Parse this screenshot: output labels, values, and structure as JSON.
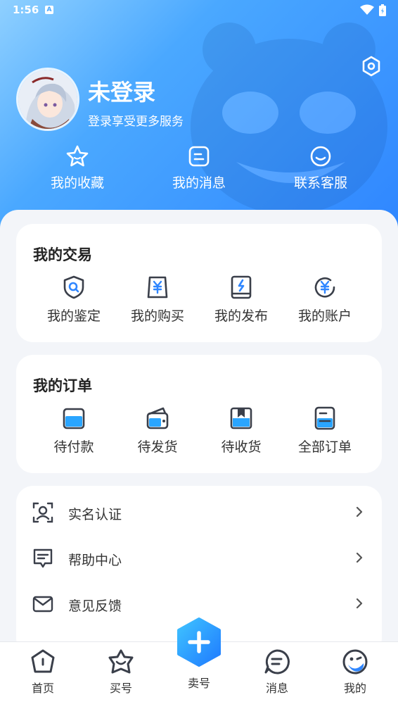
{
  "status_bar": {
    "time": "1:56",
    "notification_badge": "A"
  },
  "profile": {
    "name": "未登录",
    "subtitle": "登录享受更多服务"
  },
  "quick_actions": [
    {
      "label": "我的收藏",
      "icon": "star-icon"
    },
    {
      "label": "我的消息",
      "icon": "message-icon"
    },
    {
      "label": "联系客服",
      "icon": "smile-icon"
    }
  ],
  "trade": {
    "title": "我的交易",
    "items": [
      {
        "label": "我的鉴定",
        "icon": "shield-search-icon"
      },
      {
        "label": "我的购买",
        "icon": "yen-bag-icon"
      },
      {
        "label": "我的发布",
        "icon": "book-publish-icon"
      },
      {
        "label": "我的账户",
        "icon": "yen-circle-icon"
      }
    ]
  },
  "orders": {
    "title": "我的订单",
    "items": [
      {
        "label": "待付款",
        "icon": "card-icon"
      },
      {
        "label": "待发货",
        "icon": "wallet-icon"
      },
      {
        "label": "待收货",
        "icon": "box-icon"
      },
      {
        "label": "全部订单",
        "icon": "list-doc-icon"
      }
    ]
  },
  "menu": [
    {
      "label": "实名认证",
      "icon": "user-verify-icon"
    },
    {
      "label": "帮助中心",
      "icon": "help-chat-icon"
    },
    {
      "label": "意见反馈",
      "icon": "mail-icon"
    }
  ],
  "tabbar": {
    "tabs": [
      {
        "label": "首页",
        "icon": "home-icon"
      },
      {
        "label": "买号",
        "icon": "buy-icon"
      },
      {
        "label": "卖号",
        "icon": "plus-hex-icon"
      },
      {
        "label": "消息",
        "icon": "chat-icon"
      },
      {
        "label": "我的",
        "icon": "profile-face-icon",
        "active": true
      }
    ]
  },
  "colors": {
    "accent": "#2f86ff",
    "accent_light": "#4aa8ff",
    "icon_dark": "#3a3f4a"
  }
}
